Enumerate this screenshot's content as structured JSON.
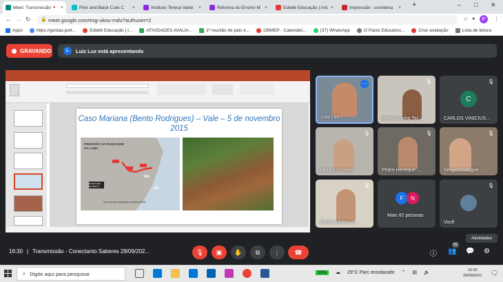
{
  "tabs": [
    {
      "label": "Meet: Transmissão",
      "color": "#00897b"
    },
    {
      "label": "Pink and Black Cute C",
      "color": "#00c4cc"
    },
    {
      "label": "Instituto Teresa Valsé",
      "color": "#8a2be2"
    },
    {
      "label": "Reforma do Ensino M",
      "color": "#8a2be2"
    },
    {
      "label": "Edebê Educação | Iníc",
      "color": "#e53935"
    },
    {
      "label": "Impressão - coordena",
      "color": "#c62828"
    }
  ],
  "new_tab": "+",
  "window_controls": {
    "minimize": "–",
    "maximize": "□",
    "close": "✕"
  },
  "address": {
    "url": "meet.google.com/esg-ukou-mdu?authuser=2",
    "profile": "P"
  },
  "bookmarks": [
    {
      "label": "Apps",
      "color": "#1a73e8"
    },
    {
      "label": "https://gestao.port...",
      "color": "#4285f4"
    },
    {
      "label": "Edebê Educação | I...",
      "color": "#e53935"
    },
    {
      "label": "ATIVIDADES AVALIA...",
      "color": "#34a853"
    },
    {
      "label": "1ª reunião de pais e...",
      "color": "#34a853"
    },
    {
      "label": "OBMEP - Calendári...",
      "color": "#e53935"
    },
    {
      "label": "(37) WhatsApp",
      "color": "#25d366"
    },
    {
      "label": "O Pacto Educativo...",
      "color": "#757575"
    },
    {
      "label": "Criar avaliação",
      "color": "#e53935"
    },
    {
      "label": "Lista de leitura",
      "color": "#757575"
    }
  ],
  "recording": {
    "label": "GRAVANDO"
  },
  "presenting": {
    "avatar": "L",
    "text": "Luiz Luz está apresentando"
  },
  "slide": {
    "title": "Caso Mariana (Bento Rodrigues) – Vale – 5 de novembro 2015",
    "map_label": "PREVISÃO DA PASSAGEM DA LAMA",
    "state_mg": "MG",
    "state_es": "ES",
    "map_tag": "BARRAGEM DE BENTO",
    "map_caption": "Área da lama Ilustração da lama (2015)"
  },
  "participants": [
    {
      "name": "Luiz Luz"
    },
    {
      "name": "Orleni Cunha Tor..."
    },
    {
      "name": "CARLOS VINICIUS...",
      "avatar": "C",
      "avatar_color": "#1e7c5a"
    },
    {
      "name": "Samira Girarola"
    },
    {
      "name": "Pedro Henrique ..."
    },
    {
      "name": "Sergio Rodrigue..."
    },
    {
      "name": "Carlos Alberto d..."
    },
    {
      "name": "Mais 82 pessoas",
      "avatars": [
        "F",
        "N"
      ]
    },
    {
      "name": "Você"
    }
  ],
  "activities": "Atividades",
  "controls": {
    "time": "16:30",
    "separator": "|",
    "meeting_title": "Transmissão - Conectanto Saberes 28/09/202...",
    "participant_count": "91"
  },
  "taskbar": {
    "search_placeholder": "Digite aqui para pesquisar",
    "battery": "39%",
    "weather": "29°C Parc ensolarado",
    "time": "16:30",
    "date": "28/09/2021"
  }
}
